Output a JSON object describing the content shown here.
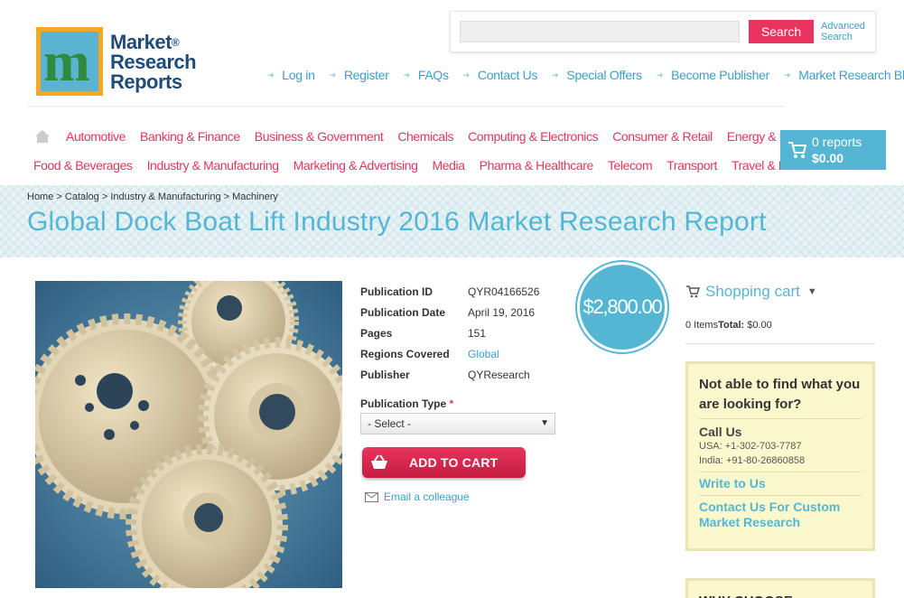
{
  "logo": {
    "line1": "Market",
    "line2": "Research",
    "line3": "Reports",
    "registered": "®",
    "mark": "m"
  },
  "search": {
    "placeholder": "",
    "button_label": "Search",
    "advanced_label": "Advanced Search"
  },
  "top_links": [
    "Log in",
    "Register",
    "FAQs",
    "Contact Us",
    "Special Offers",
    "Become Publisher",
    "Market Research Blog"
  ],
  "categories_row1": [
    "Automotive",
    "Banking & Finance",
    "Business & Government",
    "Chemicals",
    "Computing & Electronics",
    "Consumer & Retail",
    "Energy & Utilities"
  ],
  "categories_row2": [
    "Food & Beverages",
    "Industry & Manufacturing",
    "Marketing & Advertising",
    "Media",
    "Pharma & Healthcare",
    "Telecom",
    "Transport",
    "Travel & Leisure"
  ],
  "cart_button": {
    "count": "0 reports",
    "total": "$0.00"
  },
  "breadcrumb": "Home > Catalog > Industry & Manufacturing > Machinery",
  "page_title": "Global Dock Boat Lift Industry 2016 Market Research Report",
  "details": {
    "rows": [
      {
        "label": "Publication ID",
        "value": "QYR04166526"
      },
      {
        "label": "Publication Date",
        "value": "April 19, 2016"
      },
      {
        "label": "Pages",
        "value": "151"
      },
      {
        "label": "Regions Covered",
        "value": "Global"
      },
      {
        "label": "Publisher",
        "value": "QYResearch"
      }
    ]
  },
  "price": "$2,800.00",
  "publication_type": {
    "label": "Publication Type",
    "required_mark": "*",
    "selected": "- Select -"
  },
  "add_to_cart_label": "ADD TO CART",
  "email_colleague_label": "Email a colleague",
  "sidebar": {
    "shopping_cart_title": "Shopping cart",
    "items_text": "0 Items",
    "total_label": "Total:",
    "total_value": "$0.00",
    "help_title": "Not able to find what you are looking for?",
    "call_us": "Call Us",
    "phone_usa": "USA: +1-302-703-7787",
    "phone_india": "India: +91-80-26860858",
    "write_to_us": "Write to Us",
    "contact_custom": "Contact Us For Custom Market Research",
    "why_choose": "WHY CHOOSE"
  },
  "colors": {
    "accent_blue": "#55b6d4",
    "accent_pink": "#e8345e",
    "help_bg": "#fcf8cd"
  }
}
